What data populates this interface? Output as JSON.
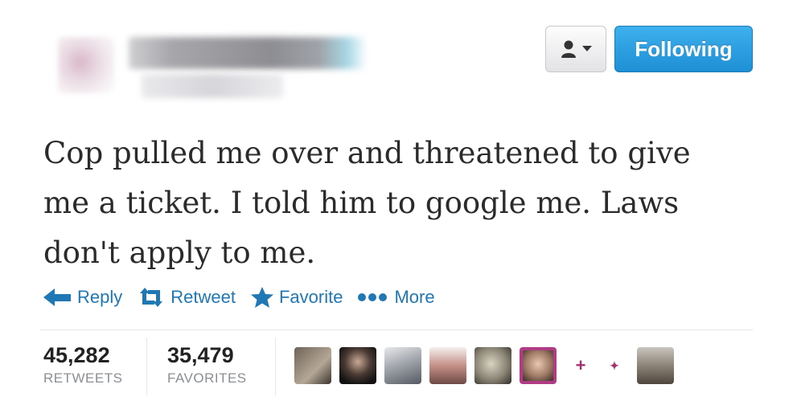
{
  "header": {
    "follow_button": "Following"
  },
  "tweet": {
    "text_lines": [
      "Cop pulled me over and threatened to give",
      "me a ticket. I told him to google me. Laws",
      "don't apply to me."
    ]
  },
  "actions": [
    {
      "label": "Reply",
      "icon": "reply-arrow-icon"
    },
    {
      "label": "Retweet",
      "icon": "retweet-icon"
    },
    {
      "label": "Favorite",
      "icon": "star-icon"
    },
    {
      "label": "More",
      "icon": "more-dots-icon"
    }
  ],
  "stats": {
    "retweets_count": "45,282",
    "retweets_label": "RETWEETS",
    "favorites_count": "35,479",
    "favorites_label": "FAVORITES"
  },
  "colors": {
    "accent": "#1f78b4",
    "button_blue": "#2a9fe2",
    "text": "#2b2b2b",
    "muted": "#8b8f93"
  }
}
